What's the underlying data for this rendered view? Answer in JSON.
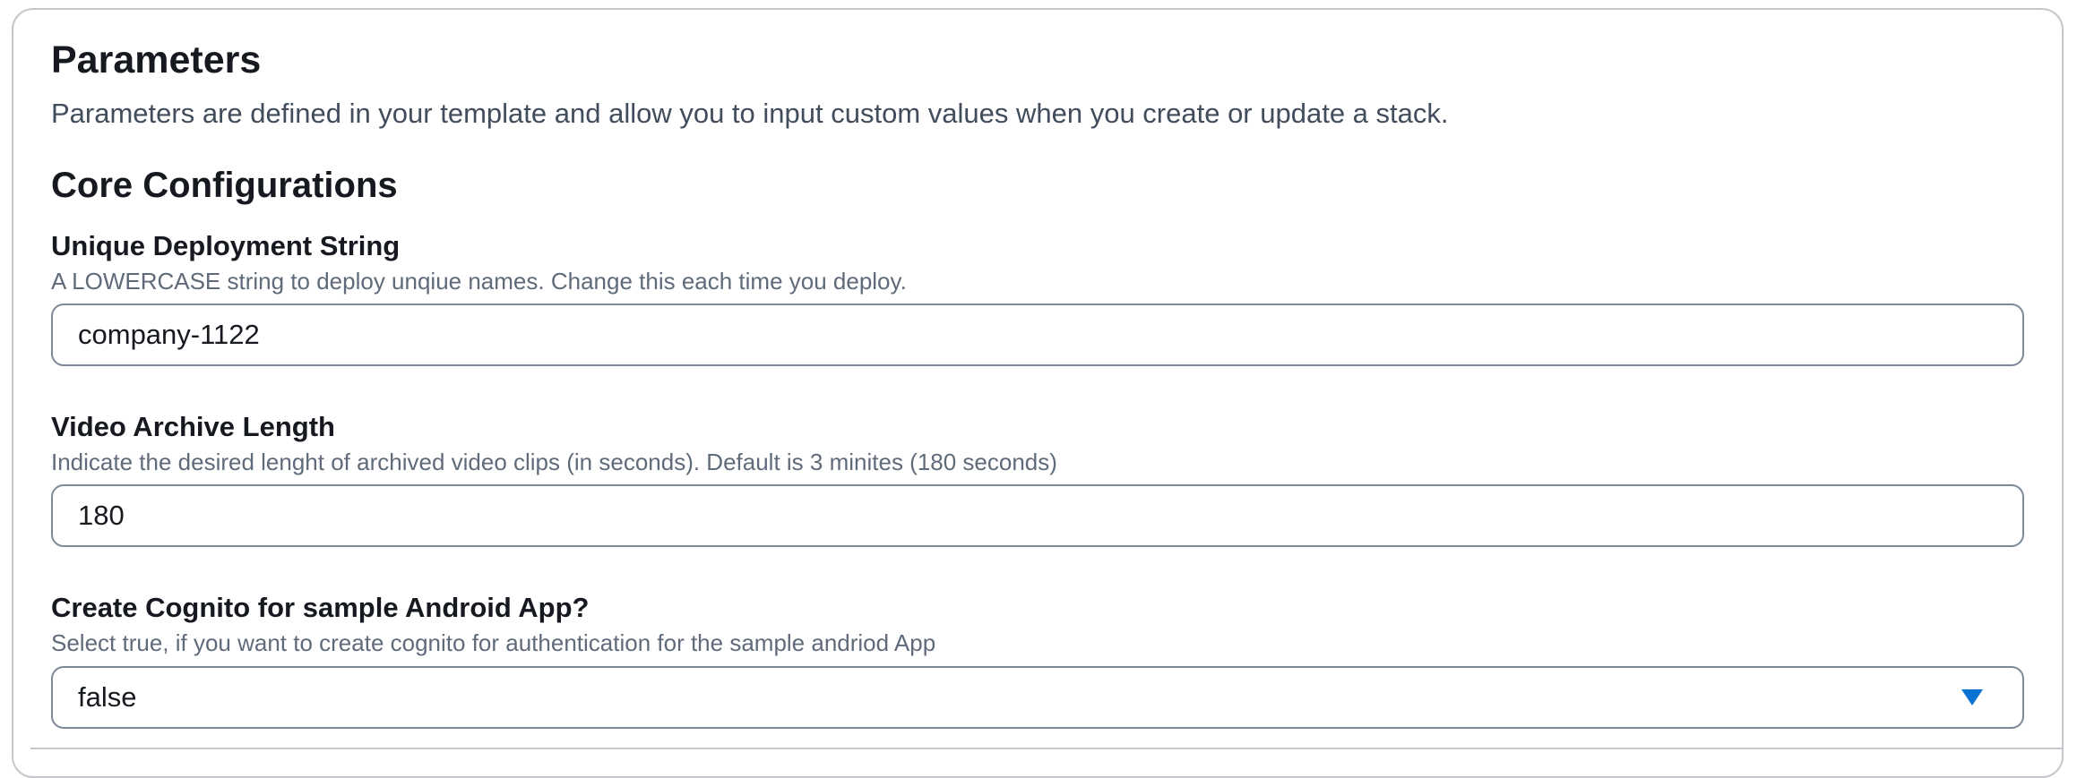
{
  "parameters": {
    "title": "Parameters",
    "description": "Parameters are defined in your template and allow you to input custom values when you create or update a stack."
  },
  "core": {
    "title": "Core Configurations",
    "fields": [
      {
        "label": "Unique Deployment String",
        "hint": "A LOWERCASE string to deploy unqiue names. Change this each time you deploy.",
        "value": "company-1122"
      },
      {
        "label": "Video Archive Length",
        "hint": "Indicate the desired lenght of archived video clips (in seconds). Default is 3 minites (180 seconds)",
        "value": "180"
      },
      {
        "label": "Create Cognito for sample Android App?",
        "hint": "Select true, if you want to create cognito for authentication for the sample andriod App",
        "value": "false"
      }
    ]
  },
  "colors": {
    "accent": "#0972d3",
    "border": "#7d8998",
    "text": "#16191f",
    "hint": "#5f6b7a"
  },
  "icons": {
    "select_caret": "caret-down-icon"
  }
}
